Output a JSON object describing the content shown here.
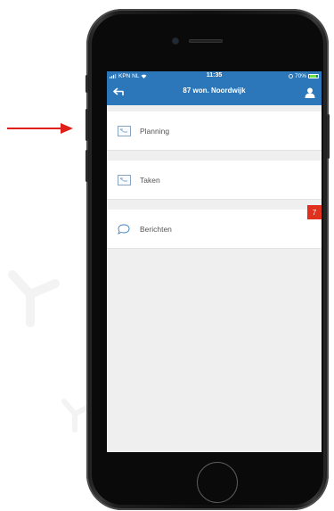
{
  "status_bar": {
    "carrier": "KPN NL",
    "time": "11:35",
    "battery": "70%",
    "battery_level": 0.7
  },
  "header": {
    "title": "87 won. Noordwijk",
    "back_icon": "back-arrow-icon",
    "profile_icon": "user-icon",
    "background_color": "#2c77b9"
  },
  "menu": {
    "items": [
      {
        "label": "Planning",
        "icon": "calendar-card-icon"
      },
      {
        "label": "Taken",
        "icon": "calendar-card-icon"
      },
      {
        "label": "Berichten",
        "icon": "chat-bubble-icon",
        "badge": "7"
      }
    ]
  },
  "colors": {
    "accent": "#2c77b9",
    "badge": "#e0301e",
    "pointer_arrow": "#e0201a"
  }
}
